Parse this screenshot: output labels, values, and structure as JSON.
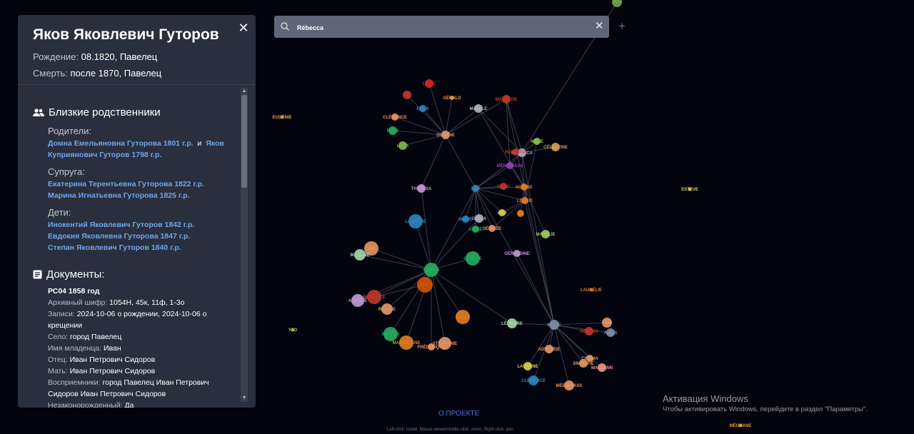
{
  "person": {
    "name": "Яков Яковлевич Гуторов",
    "birth_label": "Рождение:",
    "birth_value": "08.1820, Павелец",
    "death_label": "Смерть:",
    "death_value": "после 1870, Павелец"
  },
  "relatives": {
    "heading": "Близкие родственники",
    "parents_label": "Родители:",
    "parent1": "Домна Емельяновна Гуторова 1801 г.р.",
    "and": "и",
    "parent2_part1": "Яков",
    "parent2_part2": "Куприянович Гуторов 1798 г.р.",
    "spouse_label": "Супруга:",
    "spouses": [
      "Екатерина Терентьевна Гуторова 1822 г.р.",
      "Марина Игнатьевна Гуторова 1825 г.р."
    ],
    "children_label": "Дети:",
    "children": [
      "Инокентий Яковлевич Гуторов 1842 г.р.",
      "Евдокия Яковлевна Гуторова 1847 г.р.",
      "Степан Яковлевич Гуторов 1840 г.р."
    ]
  },
  "documents": {
    "heading": "Документы:",
    "doc_title": "РС04 1858 год",
    "archive_label": "Архивный шифр:",
    "archive_value": "1054Н, 45к, 11ф, 1-3о",
    "records_label": "Записи:",
    "records_value1": "2024-10-06 о рождении, 2024-10-06 о",
    "records_value2": "крещении",
    "village_label": "Село:",
    "village_value": "город Павелец",
    "baby_label": "Имя младенца:",
    "baby_value": "Иван",
    "father_label": "Отец:",
    "father_value": "Иван Петрович Сидоров",
    "mother_label": "Мать:",
    "mother_value": "Иван Петрович Сидоров",
    "godparents_label": "Восприемники:",
    "godparents_value1": "город Павелец Иван Петрович",
    "godparents_value2": "Сидоров Иван Петрович Сидоров",
    "illegit_label": "Незаконорожденный:",
    "illegit_value": "Да"
  },
  "search": {
    "value": "Rébecca",
    "placeholder": ""
  },
  "footer": {
    "about": "О ПРОЕКТЕ",
    "hint": "Left-click: rotate, Mouse-wheel/middle-click: zoom, Right-click: pan"
  },
  "windows": {
    "line1": "Активация Windows",
    "line2": "Чтобы активировать Windows, перейдите в раздел \"Параметры\"."
  },
  "graph": {
    "nodes": [
      {
        "label": "You",
        "color": "#6ea84a"
      },
      {
        "label": "Eugénie",
        "color": "#d9a441"
      },
      {
        "label": "Esteve",
        "color": "#d9d24a"
      },
      {
        "label": "Yao",
        "color": "#9ecb3a"
      },
      {
        "label": "Laurélie",
        "color": "#e67e22"
      },
      {
        "label": "Méghane",
        "color": "#e89a3c"
      },
      {
        "label": "Lilou",
        "color": "#d42a2a"
      },
      {
        "label": "Yao",
        "color": "#c0392b"
      },
      {
        "label": "Gérald",
        "color": "#e89a3c"
      },
      {
        "label": "Mathilde",
        "color": "#c0392b"
      },
      {
        "label": "Ellis",
        "color": "#2e86c1"
      },
      {
        "label": "Maëlle",
        "color": "#aeb6bf"
      },
      {
        "label": "Clémence",
        "color": "#e59866"
      },
      {
        "label": "Océane",
        "color": "#e59866"
      },
      {
        "label": "Rose",
        "color": "#27ae60"
      },
      {
        "label": "Luca",
        "color": "#82b74b"
      },
      {
        "label": "Nélie",
        "color": "#8bc34a"
      },
      {
        "label": "Célestine",
        "color": "#d4a057"
      },
      {
        "label": "Rébecca",
        "color": "#aeb6bf"
      },
      {
        "label": "Rebecca",
        "color": "#c0392b"
      },
      {
        "label": "Médiamass",
        "color": "#8e44ad"
      },
      {
        "label": "Thérèsa",
        "color": "#c39bd3"
      },
      {
        "label": "Léo",
        "color": "#2e86c1"
      },
      {
        "label": "Coco",
        "color": "#c0392b"
      },
      {
        "label": "Noémie",
        "color": "#e67e22"
      },
      {
        "label": "Léonie",
        "color": "#e67e22"
      },
      {
        "label": "Ty",
        "color": "#e67e22"
      },
      {
        "label": "Laurène",
        "color": "#2e86c1"
      },
      {
        "label": "Marie",
        "color": "#2e86c1"
      },
      {
        "label": "Giulia",
        "color": "#aeb6bf"
      },
      {
        "label": "Ayo",
        "color": "#d9d24a"
      },
      {
        "label": "Angie",
        "color": "#27ae60"
      },
      {
        "label": "Désirée",
        "color": "#e59866"
      },
      {
        "label": "Mahélie",
        "color": "#9ccc65"
      },
      {
        "label": "Wa",
        "color": "#e59866"
      },
      {
        "label": "Maëline",
        "color": "#a5d6a7"
      },
      {
        "label": "Gérène",
        "color": "#27ae60"
      },
      {
        "label": "Géraldine",
        "color": "#c39bd3"
      },
      {
        "label": "Sophia",
        "color": "#27ae60"
      },
      {
        "label": "Vénus",
        "color": "#d35400"
      },
      {
        "label": "Bérénice",
        "color": "#c0392b"
      },
      {
        "label": "Aurélie",
        "color": "#c39bd3"
      },
      {
        "label": "Réjane",
        "color": "#e59866"
      },
      {
        "label": "Estée",
        "color": "#e67e22"
      },
      {
        "label": "Noëlla",
        "color": "#27ae60"
      },
      {
        "label": "Magdalene",
        "color": "#e67e22"
      },
      {
        "label": "Frédérique",
        "color": "#e59866"
      },
      {
        "label": "Stéphanie",
        "color": "#e59866"
      },
      {
        "label": "Léonore",
        "color": "#a5d6a7"
      },
      {
        "label": "Ménie",
        "color": "#7f8fa6"
      },
      {
        "label": "Yoü",
        "color": "#e59866"
      },
      {
        "label": "Anaïs",
        "color": "#7f8fa6"
      },
      {
        "label": "Rébéna",
        "color": "#c0392b"
      },
      {
        "label": "Adélaïde",
        "color": "#e59866"
      },
      {
        "label": "Cinéma",
        "color": "#e59866"
      },
      {
        "label": "Simplifié",
        "color": "#e59866"
      },
      {
        "label": "Maëlann",
        "color": "#f1948a"
      },
      {
        "label": "Laurène",
        "color": "#d9d24a"
      },
      {
        "label": "Clémence",
        "color": "#2e86c1"
      },
      {
        "label": "Médiamass",
        "color": "#e59866"
      }
    ]
  }
}
